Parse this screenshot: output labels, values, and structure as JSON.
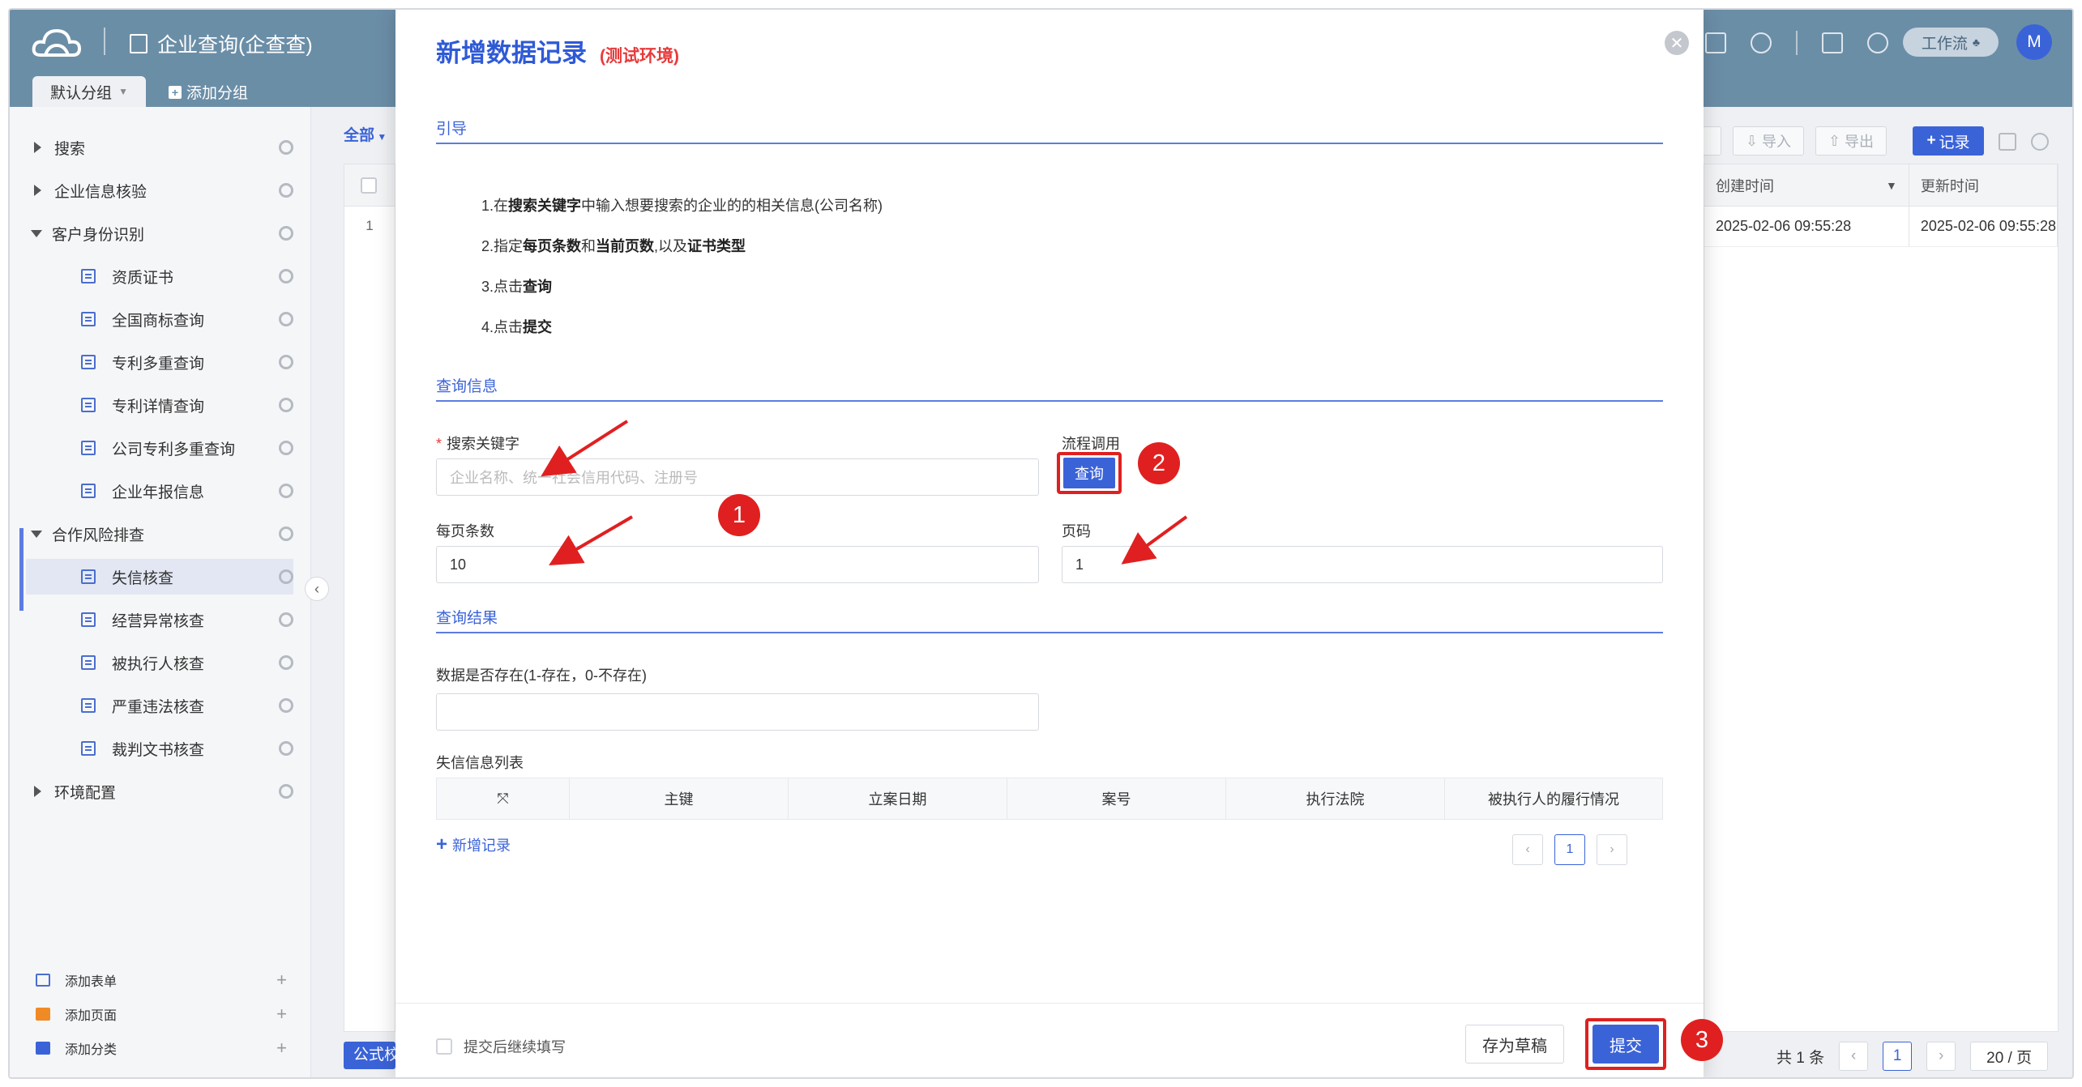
{
  "app": {
    "title": "企业查询(企查查)",
    "group_tab": "默认分组",
    "add_group": "添加分组",
    "workflow_button": "工作流",
    "avatar_letter": "M"
  },
  "sidebar": {
    "items": [
      {
        "label": "搜索",
        "level": 0,
        "expanded": false
      },
      {
        "label": "企业信息核验",
        "level": 0,
        "expanded": false
      },
      {
        "label": "客户身份识别",
        "level": 0,
        "expanded": true
      },
      {
        "label": "资质证书",
        "level": 1
      },
      {
        "label": "全国商标查询",
        "level": 1
      },
      {
        "label": "专利多重查询",
        "level": 1
      },
      {
        "label": "专利详情查询",
        "level": 1
      },
      {
        "label": "公司专利多重查询",
        "level": 1
      },
      {
        "label": "企业年报信息",
        "level": 1
      },
      {
        "label": "合作风险排查",
        "level": 0,
        "expanded": true
      },
      {
        "label": "失信核查",
        "level": 1,
        "active": true
      },
      {
        "label": "经营异常核查",
        "level": 1
      },
      {
        "label": "被执行人核查",
        "level": 1
      },
      {
        "label": "严重违法核查",
        "level": 1
      },
      {
        "label": "裁判文书核查",
        "level": 1
      },
      {
        "label": "环境配置",
        "level": 0,
        "expanded": false
      }
    ],
    "bottom": {
      "add_form": "添加表单",
      "add_page": "添加页面",
      "add_category": "添加分类"
    }
  },
  "list": {
    "filter": "全部",
    "row_number": "1",
    "formula_button": "公式校验",
    "toolbar": {
      "import": "导入",
      "export": "导出",
      "record": "记录"
    },
    "columns": {
      "created": "创建时间",
      "updated": "更新时间"
    },
    "row": {
      "created": "2025-02-06 09:55:28",
      "updated": "2025-02-06 09:55:28"
    },
    "pager": {
      "total": "共 1 条",
      "page": "1",
      "page_size": "20 / 页"
    }
  },
  "modal": {
    "title": "新增数据记录",
    "env": "(测试环境)",
    "sections": {
      "guide": "引导",
      "query_info": "查询信息",
      "query_result": "查询结果"
    },
    "guide_steps": [
      {
        "prefix": "1.在",
        "b1": "搜索关键字",
        "mid": "中输入想要搜索的企业的的相关信息(公司名称)",
        "b2": "",
        "mid2": "",
        "b3": ""
      },
      {
        "prefix": "2.指定",
        "b1": "每页条数",
        "mid": "和",
        "b2": "当前页数",
        "mid2": ",以及",
        "b3": "证书类型"
      },
      {
        "prefix": "3.点击",
        "b1": "查询",
        "mid": "",
        "b2": "",
        "mid2": "",
        "b3": ""
      },
      {
        "prefix": "4.点击",
        "b1": "提交",
        "mid": "",
        "b2": "",
        "mid2": "",
        "b3": ""
      }
    ],
    "fields": {
      "keyword_label": "搜索关键字",
      "keyword_placeholder": "企业名称、统一社会信用代码、注册号",
      "flow_label": "流程调用",
      "query_button": "查询",
      "page_size_label": "每页条数",
      "page_size_value": "10",
      "page_label": "页码",
      "page_value": "1",
      "exists_label": "数据是否存在(1-存在，0-不存在)",
      "exists_value": "",
      "list_label": "失信信息列表"
    },
    "subtable_columns": [
      "主键",
      "立案日期",
      "案号",
      "执行法院",
      "被执行人的履行情况"
    ],
    "add_record": "新增记录",
    "sub_pager_page": "1",
    "footer": {
      "continue_label": "提交后继续填写",
      "draft_button": "存为草稿",
      "submit_button": "提交"
    }
  },
  "annotations": {
    "badge1": "1",
    "badge2": "2",
    "badge3": "3",
    "color": "#e02020"
  },
  "colors": {
    "accent": "#3b63d8",
    "topbar": "#6b8ea7",
    "danger": "#e02020"
  }
}
